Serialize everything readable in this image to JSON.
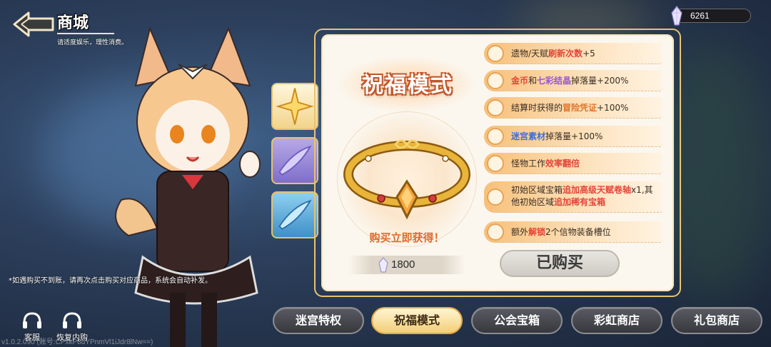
{
  "header": {
    "title": "商城",
    "subtitle": "请适度娱乐，理性消费。"
  },
  "currency": {
    "icon": "crystal-icon",
    "value": "6261"
  },
  "side_tabs": [
    {
      "icon": "star-icon",
      "selected": true
    },
    {
      "icon": "purple-feather-icon",
      "selected": false
    },
    {
      "icon": "blue-feather-icon",
      "selected": false
    }
  ],
  "panel": {
    "title": "祝福模式",
    "item_icon": "golden-bracelet-icon",
    "buy_label": "购买立即获得！",
    "price": "1800",
    "price_icon": "crystal-icon",
    "purchased_label": "已购买",
    "perks": [
      {
        "icon": "token-icon",
        "parts": [
          {
            "t": "遗物/天赋"
          },
          {
            "t": "刷新次数",
            "c": "red"
          },
          {
            "t": "+5"
          }
        ]
      },
      {
        "icon": "coin-crystal-icon",
        "parts": [
          {
            "t": "金币",
            "c": "red"
          },
          {
            "t": "和"
          },
          {
            "t": "七彩结晶",
            "c": "purple"
          },
          {
            "t": "掉落量+200%"
          }
        ]
      },
      {
        "icon": "scroll-icon",
        "parts": [
          {
            "t": "结算时获得的"
          },
          {
            "t": "冒险凭证",
            "c": "orange"
          },
          {
            "t": "+100%"
          }
        ]
      },
      {
        "icon": "material-icon",
        "parts": [
          {
            "t": "迷宫素材",
            "c": "blue"
          },
          {
            "t": "掉落量+100%"
          }
        ]
      },
      {
        "icon": "clock-icon",
        "parts": [
          {
            "t": "怪物工作"
          },
          {
            "t": "效率翻倍",
            "c": "red"
          }
        ]
      },
      {
        "icon": "chest-icon",
        "tall": true,
        "parts": [
          {
            "t": "初始区域宝箱"
          },
          {
            "t": "追加高级天赋卷轴",
            "c": "red"
          },
          {
            "t": "x1,其他初始区域"
          },
          {
            "t": "追加稀有宝箱",
            "c": "red"
          }
        ]
      },
      {
        "icon": "slot-icon",
        "parts": [
          {
            "t": "额外"
          },
          {
            "t": "解锁",
            "c": "red"
          },
          {
            "t": "2个信物装备槽位"
          }
        ]
      }
    ]
  },
  "tabs": [
    {
      "label": "迷宫特权",
      "active": false
    },
    {
      "label": "祝福模式",
      "active": true
    },
    {
      "label": "公会宝箱",
      "active": false
    },
    {
      "label": "彩虹商店",
      "active": false
    },
    {
      "label": "礼包商店",
      "active": false
    }
  ],
  "notice": "*如遇购买不到账，请再次点击购买对应商品，系统会自动补发。",
  "support": [
    {
      "label": "客服",
      "icon": "headset-icon"
    },
    {
      "label": "恢复内购",
      "icon": "headset-icon"
    }
  ],
  "version_text": "v1.0.2.090    (账号:CPxkP8dYPnmVl1iJdr8lNw==)",
  "colors": {
    "accent_gold": "#e7c371",
    "title_orange": "#c2572a",
    "highlight_red": "#e2463a"
  }
}
